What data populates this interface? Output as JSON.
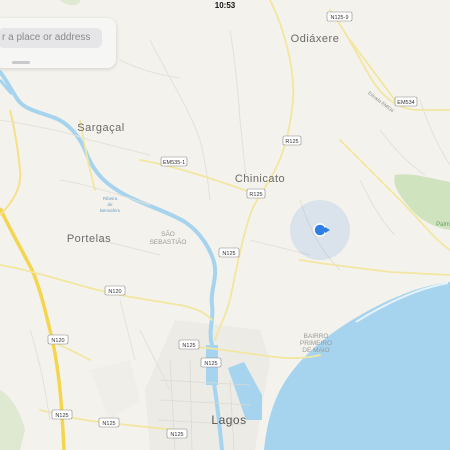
{
  "status_bar": {
    "time": "10:53"
  },
  "search": {
    "placeholder": "r a place or address"
  },
  "place_labels": {
    "odiaxere": "Odiáxere",
    "sargacal": "Sargaçal",
    "chinicato": "Chinicato",
    "portelas": "Portelas",
    "sao_sebastiao_1": "SÃO",
    "sao_sebastiao_2": "SEBASTIÃO",
    "bairro_1": "BAIRRO",
    "bairro_2": "PRIMEIRO",
    "bairro_3": "DE MAIO",
    "lagos": "Lagos",
    "ribeira_1": "Ribeira",
    "ribeira_2": "de",
    "ribeira_3": "Bensafrim",
    "estrada": "Estrada EM534",
    "palm": "Palm"
  },
  "road_shields": {
    "n125_9": "N125-9",
    "em534": "EM534",
    "r125_a": "R125",
    "em535": "EM535-1",
    "r125_b": "R125",
    "n125_c": "N125",
    "n120_a": "N120",
    "n120_b": "N120",
    "n125_d": "N125",
    "n125_e": "N125",
    "n125_f": "N125",
    "n125_g": "N125",
    "n125_h": "N125"
  },
  "colors": {
    "water": "#a6d3ee",
    "land": "#f4f2ec",
    "park": "#cfe3be",
    "yellow_road": "#f4d54e",
    "user_location": "#2f7ee6"
  },
  "icons": {
    "user_location": "user-location-dot-icon",
    "search": "search-field"
  }
}
